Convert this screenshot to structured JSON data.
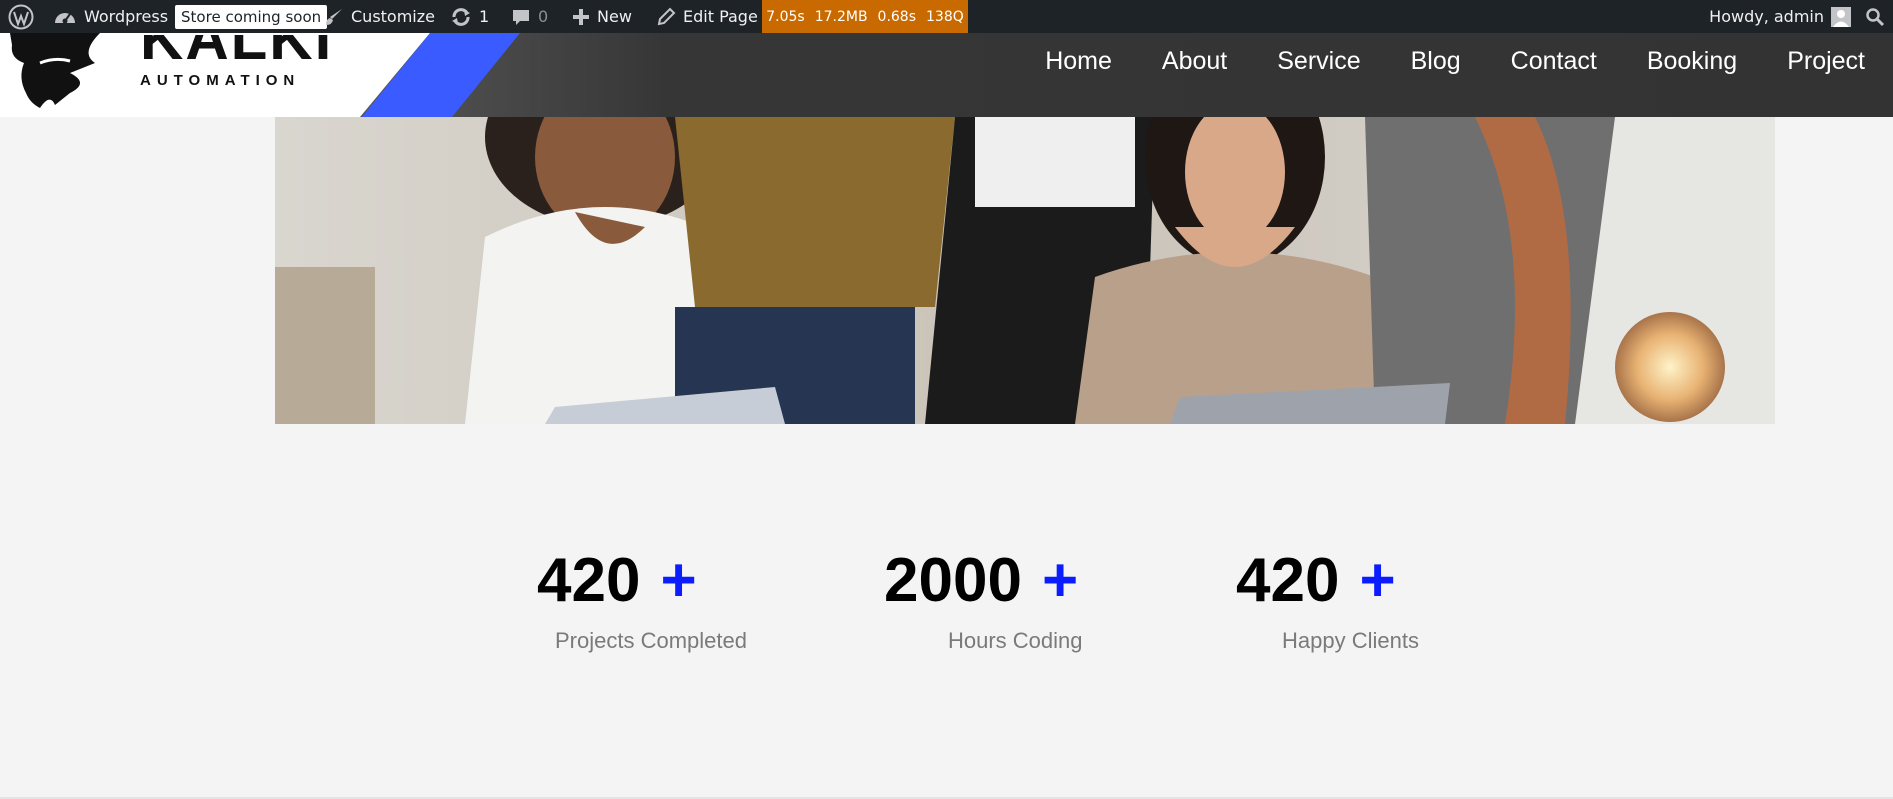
{
  "adminbar": {
    "site_name": "Wordpress",
    "store_badge": "Store coming soon",
    "customize": "Customize",
    "updates_count": "1",
    "comments_count": "0",
    "new_label": "New",
    "edit_page": "Edit Page",
    "query_monitor": {
      "time": "7.05s",
      "memory": "17.2MB",
      "db_time": "0.68s",
      "queries": "138Q"
    },
    "howdy": "Howdy, admin"
  },
  "logo": {
    "word": "KALKI",
    "sub": "AUTOMATION"
  },
  "nav": [
    "Home",
    "About",
    "Service",
    "Blog",
    "Contact",
    "Booking",
    "Project"
  ],
  "counters": [
    {
      "number": "420",
      "suffix": "+",
      "label": "Projects Completed"
    },
    {
      "number": "2000",
      "suffix": "+",
      "label": "Hours Coding"
    },
    {
      "number": "420",
      "suffix": "+",
      "label": "Happy Clients"
    }
  ],
  "colors": {
    "adminbar": "#1d2327",
    "qm": "#c96a00",
    "accent_blue": "#0b1dff",
    "logo_blue": "#3a5bff",
    "page_bg": "#f4f4f4"
  },
  "icons": [
    "wordpress-icon",
    "dashboard-icon",
    "brush-icon",
    "refresh-icon",
    "comment-icon",
    "plus-icon",
    "pencil-icon",
    "avatar-icon",
    "search-icon"
  ]
}
